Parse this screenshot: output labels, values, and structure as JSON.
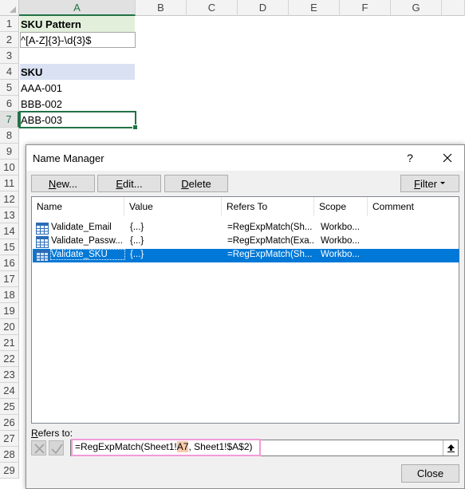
{
  "sheet": {
    "columns": [
      "A",
      "B",
      "C",
      "D",
      "E",
      "F",
      "G"
    ],
    "rows": [
      "1",
      "2",
      "3",
      "4",
      "5",
      "6",
      "7",
      "8",
      "9",
      "10",
      "11",
      "12",
      "13",
      "14",
      "15",
      "16",
      "17",
      "18",
      "19",
      "20",
      "21",
      "22",
      "23",
      "24",
      "25",
      "26",
      "27",
      "28",
      "29"
    ],
    "cells": {
      "a1": "SKU Pattern",
      "a2": "^[A-Z]{3}-\\d{3}$",
      "a4": "SKU",
      "a5": "AAA-001",
      "a6": "BBB-002",
      "a7": "ABB-003"
    }
  },
  "dialog": {
    "title": "Name Manager",
    "help_label": "?",
    "buttons": {
      "new_u": "N",
      "new_rest": "ew...",
      "edit_u": "E",
      "edit_rest": "dit...",
      "delete_u": "D",
      "delete_rest": "elete",
      "filter_u": "F",
      "filter_rest": "ilter",
      "close_label": "Close"
    },
    "columns": [
      "Name",
      "Value",
      "Refers To",
      "Scope",
      "Comment"
    ],
    "names": [
      {
        "name": "Validate_Email",
        "value": "{...}",
        "refers_to": "=RegExpMatch(Sh...",
        "scope": "Workbo...",
        "comment": ""
      },
      {
        "name": "Validate_Passw...",
        "value": "{...}",
        "refers_to": "=RegExpMatch(Exa...",
        "scope": "Workbo...",
        "comment": ""
      },
      {
        "name": "Validate_SKU",
        "value": "{...}",
        "refers_to": "=RegExpMatch(Sh...",
        "scope": "Workbo...",
        "comment": ""
      }
    ],
    "selected_index": 2,
    "refers_to_label_u": "R",
    "refers_to_label_rest": "efers to:",
    "refers_to_value": {
      "prefix": "=RegExpMatch(Sheet1!",
      "highlight": "A7",
      "suffix": ", Sheet1!$A$2)"
    }
  },
  "colors": {
    "excel_green": "#217346",
    "header_fill_green": "#e2efda",
    "header_fill_blue": "#d9e1f2",
    "selection_blue": "#0078d7",
    "ref_highlight_pink": "#f29ad9"
  }
}
